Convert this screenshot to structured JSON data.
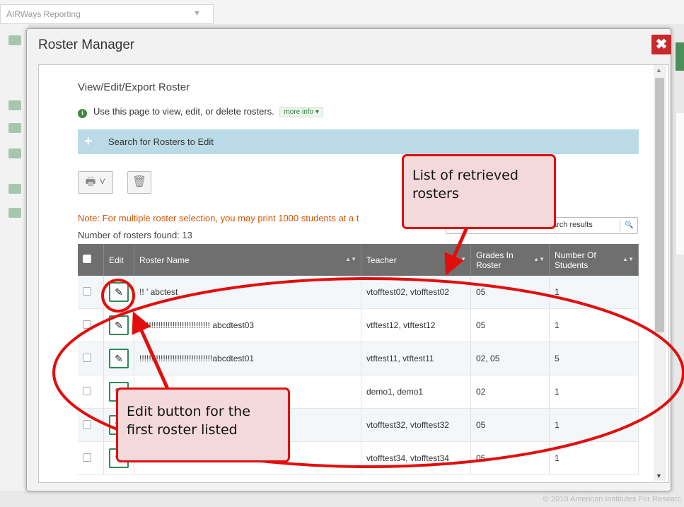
{
  "background": {
    "tab_label": "AIRWays Reporting",
    "tab_arrow": "▼",
    "copyright": "© 2019 American Institutes For Researc"
  },
  "modal": {
    "title": "Roster Manager",
    "close_glyph": "✖"
  },
  "page": {
    "section_title": "View/Edit/Export Roster",
    "info_icon": "i",
    "info_text": "Use this page to view, edit, or delete rosters.",
    "more_info_label": "more info ▾",
    "search_panel_icon": "+",
    "search_panel_label": "Search for Rosters to Edit",
    "print_button_glyph": "🖶 ˅",
    "delete_button_glyph": "🗑",
    "note": "Note: For multiple roster selection, you may print 1000 students at a t",
    "count_text": "Number of rosters found: 13",
    "search_results_text": "arch results",
    "search_results_icon": "🔍"
  },
  "table": {
    "headers": {
      "edit": "Edit",
      "roster_name": "Roster Name",
      "teacher": "Teacher",
      "grades": "Grades In Roster",
      "students": "Number Of Students"
    },
    "edit_glyph": "✎",
    "rows": [
      {
        "name": "!! ' abctest",
        "teacher": "vtofftest02, vtofftest02",
        "grades": "05",
        "students": "1"
      },
      {
        "name": "!!!!!!!!!!!!!!!!!!!!!!!!!!!!!! abcdtest03",
        "teacher": "vtftest12, vtftest12",
        "grades": "05",
        "students": "1"
      },
      {
        "name": "!!!!!!!!!!!!!!!!!!!!!!!!!!!!!!!abcdtest01",
        "teacher": "vtftest11, vtftest11",
        "grades": "02, 05",
        "students": "5"
      },
      {
        "name": "",
        "teacher": "demo1, demo1",
        "grades": "02",
        "students": "1"
      },
      {
        "name": "",
        "teacher": "vtofftest32, vtofftest32",
        "grades": "05",
        "students": "1"
      },
      {
        "name": "",
        "teacher": "vtofftest34, vtofftest34",
        "grades": "05",
        "students": "1"
      }
    ]
  },
  "annotations": {
    "callout_rosters": [
      "List of retrieved",
      "rosters"
    ],
    "callout_edit": [
      "Edit button for the",
      "first roster listed"
    ],
    "annotation_color": "#e20e0e"
  }
}
